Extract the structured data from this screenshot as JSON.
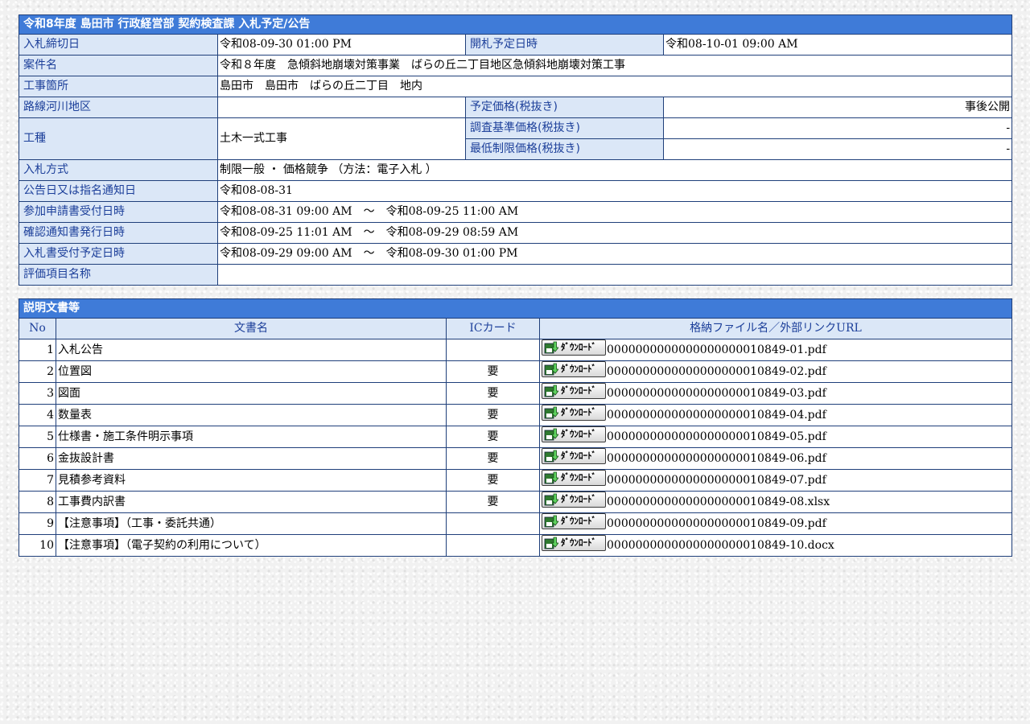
{
  "notice": {
    "title": "令和8年度 島田市 行政経営部 契約検査課 入札予定/公告",
    "fields": {
      "bid_deadline_label": "入札締切日",
      "bid_deadline": "令和08-09-30 01:00 PM",
      "opening_date_label": "開札予定日時",
      "opening_date": "令和08-10-01 09:00 AM",
      "project_name_label": "案件名",
      "project_name": "令和８年度　急傾斜地崩壊対策事業　ばらの丘二丁目地区急傾斜地崩壊対策工事",
      "location_label": "工事箇所",
      "location": "島田市　島田市　ばらの丘二丁目　地内",
      "route_label": "路線河川地区",
      "route": "",
      "planned_price_label": "予定価格(税抜き)",
      "planned_price": "事後公開",
      "work_type_label": "工種",
      "work_type": "土木一式工事",
      "survey_price_label": "調査基準価格(税抜き)",
      "survey_price": "-",
      "min_price_label": "最低制限価格(税抜き)",
      "min_price": "-",
      "bid_method_label": "入札方式",
      "bid_method": "制限一般 ・ 価格競争 （方法：電子入札 ）",
      "announce_date_label": "公告日又は指名通知日",
      "announce_date": "令和08-08-31",
      "apply_period_label": "参加申請書受付日時",
      "apply_period": "令和08-08-31 09:00 AM　～　令和08-09-25 11:00 AM",
      "confirm_period_label": "確認通知書発行日時",
      "confirm_period": "令和08-09-25 11:01 AM　～　令和08-09-29 08:59 AM",
      "bid_receive_label": "入札書受付予定日時",
      "bid_receive": "令和08-09-29 09:00 AM　～　令和08-09-30 01:00 PM",
      "eval_items_label": "評価項目名称",
      "eval_items": ""
    }
  },
  "documents": {
    "title": "説明文書等",
    "headers": {
      "no": "No",
      "name": "文書名",
      "ic": "ICカード",
      "file": "格納ファイル名／外部リンクURL"
    },
    "download_label": "ﾀﾞｳﾝﾛｰﾄﾞ",
    "rows": [
      {
        "no": "1",
        "name": "入札公告",
        "ic": "",
        "file": "0000000000000000000010849-01.pdf"
      },
      {
        "no": "2",
        "name": "位置図",
        "ic": "要",
        "file": "0000000000000000000010849-02.pdf"
      },
      {
        "no": "3",
        "name": "図面",
        "ic": "要",
        "file": "0000000000000000000010849-03.pdf"
      },
      {
        "no": "4",
        "name": "数量表",
        "ic": "要",
        "file": "0000000000000000000010849-04.pdf"
      },
      {
        "no": "5",
        "name": "仕様書・施工条件明示事項",
        "ic": "要",
        "file": "0000000000000000000010849-05.pdf"
      },
      {
        "no": "6",
        "name": "金抜設計書",
        "ic": "要",
        "file": "0000000000000000000010849-06.pdf"
      },
      {
        "no": "7",
        "name": "見積参考資料",
        "ic": "要",
        "file": "0000000000000000000010849-07.pdf"
      },
      {
        "no": "8",
        "name": "工事費内訳書",
        "ic": "要",
        "file": "0000000000000000000010849-08.xlsx"
      },
      {
        "no": "9",
        "name": "【注意事項】（工事・委託共通）",
        "ic": "",
        "file": "0000000000000000000010849-09.pdf"
      },
      {
        "no": "10",
        "name": "【注意事項】（電子契約の利用について）",
        "ic": "",
        "file": "0000000000000000000010849-10.docx"
      }
    ]
  },
  "colors": {
    "title_bar": "#3f7bd8",
    "label_bg": "#dbe7f7",
    "label_text": "#1c3f9a",
    "border": "#1f3f7a"
  }
}
